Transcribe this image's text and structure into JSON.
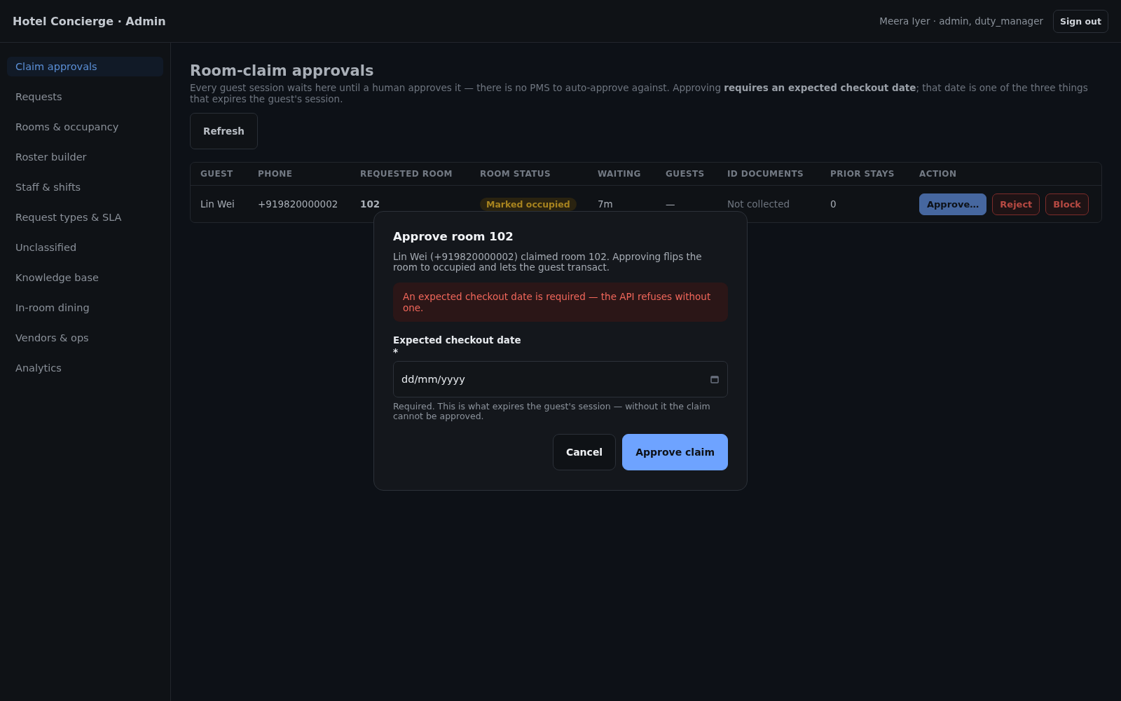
{
  "header": {
    "title": "Hotel Concierge · Admin",
    "user": "Meera Iyer · admin, duty_manager",
    "sign_out": "Sign out"
  },
  "sidebar": {
    "items": [
      {
        "label": "Claim approvals",
        "selected": true
      },
      {
        "label": "Requests",
        "selected": false
      },
      {
        "label": "Rooms & occupancy",
        "selected": false
      },
      {
        "label": "Roster builder",
        "selected": false
      },
      {
        "label": "Staff & shifts",
        "selected": false
      },
      {
        "label": "Request types & SLA",
        "selected": false
      },
      {
        "label": "Unclassified",
        "selected": false
      },
      {
        "label": "Knowledge base",
        "selected": false
      },
      {
        "label": "In-room dining",
        "selected": false
      },
      {
        "label": "Vendors & ops",
        "selected": false
      },
      {
        "label": "Analytics",
        "selected": false
      }
    ]
  },
  "page": {
    "title": "Room-claim approvals",
    "description": "Every guest session waits here until a human approves it — there is no PMS to auto-approve against. Approving **requires an expected checkout date**; that date is one of the three things that expires the guest's session.",
    "refresh": "Refresh"
  },
  "table": {
    "columns": [
      "GUEST",
      "PHONE",
      "REQUESTED ROOM",
      "ROOM STATUS",
      "WAITING",
      "GUESTS",
      "ID DOCUMENTS",
      "PRIOR STAYS",
      "ACTION"
    ],
    "rows": [
      {
        "guest": "Lin Wei",
        "phone": "+919820000002",
        "room": "102",
        "status": "Marked occupied",
        "waiting": "7m",
        "guests": "—",
        "id_documents": "Not collected",
        "prior_stays": "0",
        "actions": [
          {
            "label": "Approve…",
            "kind": "primary"
          },
          {
            "label": "Reject",
            "kind": "danger"
          },
          {
            "label": "Block",
            "kind": "danger"
          }
        ]
      }
    ]
  },
  "dialog": {
    "title": "Approve room 102",
    "message": "Lin Wei (+919820000002) claimed room 102. Approving flips the room to occupied and lets the guest transact.",
    "error": "An expected checkout date is required — the API refuses without one.",
    "field_label": "Expected checkout date",
    "required_mark": "*",
    "placeholder": "dd/mm/yyyy",
    "help": "Required. This is what expires the guest's session — without it the claim cannot be approved.",
    "buttons": [
      {
        "label": "Cancel",
        "kind": "secondary"
      },
      {
        "label": "Approve claim",
        "kind": "primary"
      }
    ]
  }
}
